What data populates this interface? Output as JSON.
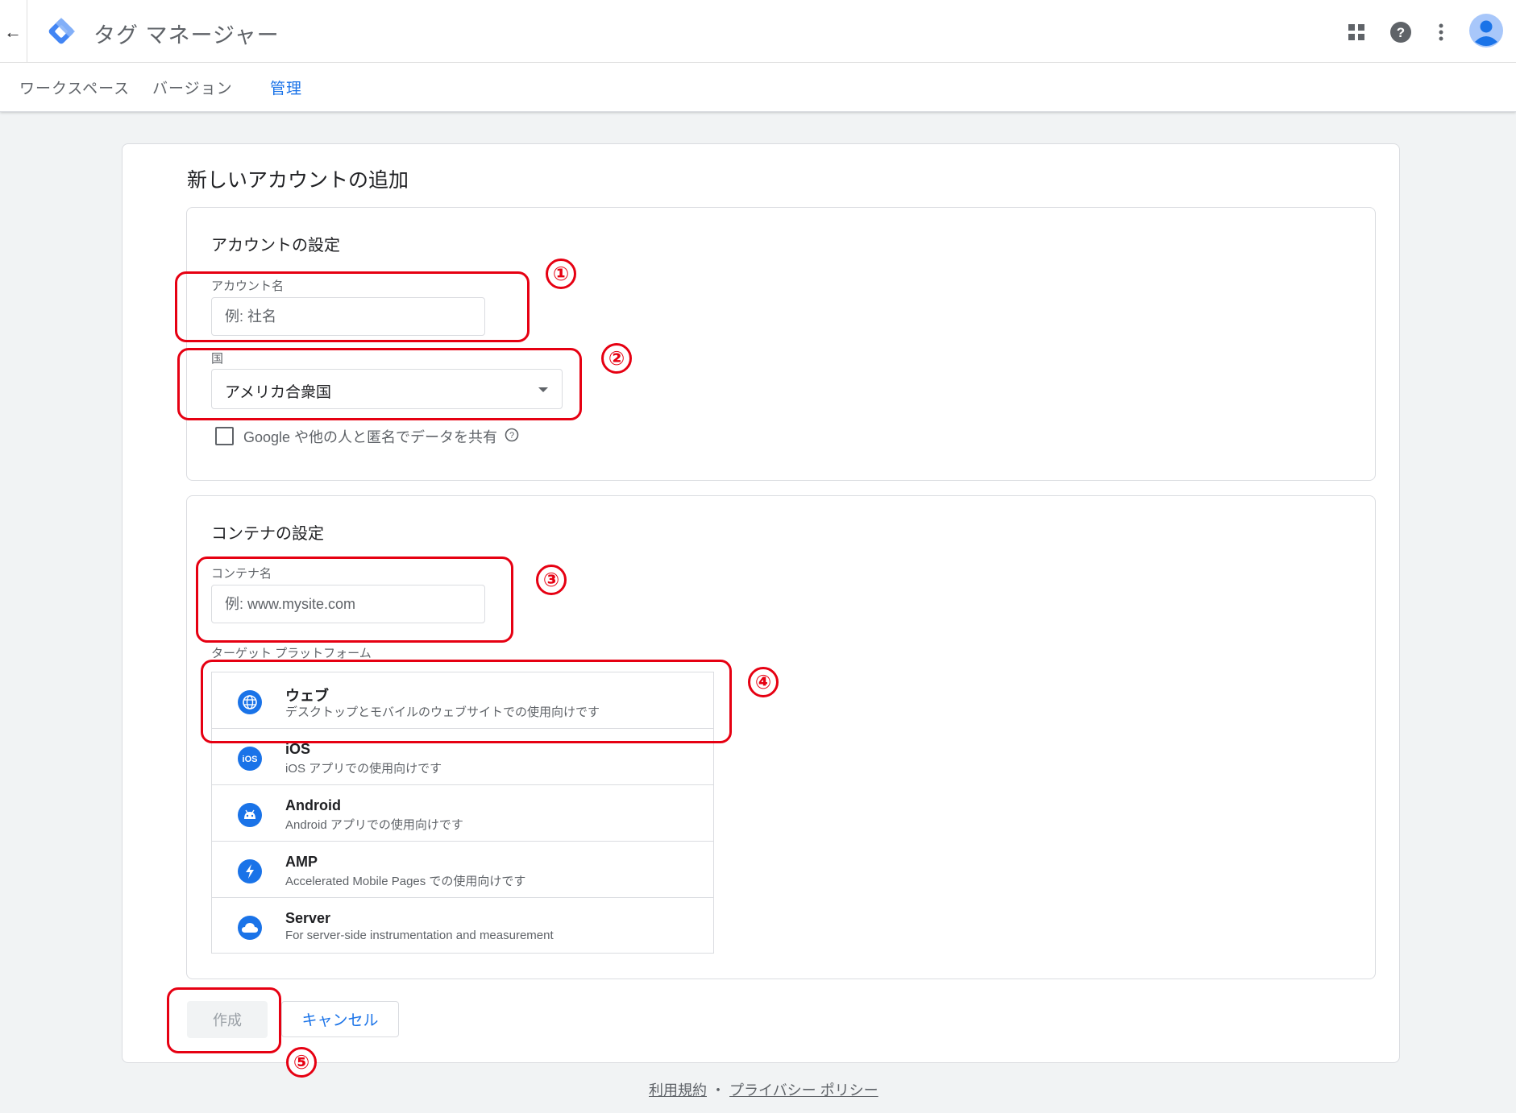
{
  "header": {
    "back_icon": "arrow-back-icon",
    "app_title": "タグ マネージャー",
    "icons": [
      "apps-grid-icon",
      "help-icon",
      "more-vert-icon",
      "account-avatar-icon"
    ]
  },
  "tabs": [
    {
      "label": "ワークスペース",
      "active": false
    },
    {
      "label": "バージョン",
      "active": false
    },
    {
      "label": "管理",
      "active": true
    }
  ],
  "page": {
    "title": "新しいアカウントの追加",
    "account_section": {
      "title": "アカウントの設定",
      "account_name_label": "アカウント名",
      "account_name_placeholder": "例: 社名",
      "country_label": "国",
      "country_value": "アメリカ合衆国",
      "share_data_label": "Google や他の人と匿名でデータを共有"
    },
    "container_section": {
      "title": "コンテナの設定",
      "container_name_label": "コンテナ名",
      "container_name_placeholder": "例: www.mysite.com",
      "platform_label": "ターゲット プラットフォーム",
      "platforms": [
        {
          "name": "ウェブ",
          "description": "デスクトップとモバイルのウェブサイトでの使用向けです",
          "icon": "globe-icon"
        },
        {
          "name": "iOS",
          "description": "iOS アプリでの使用向けです",
          "icon": "ios-icon"
        },
        {
          "name": "Android",
          "description": "Android アプリでの使用向けです",
          "icon": "android-icon"
        },
        {
          "name": "AMP",
          "description": "Accelerated Mobile Pages での使用向けです",
          "icon": "amp-bolt-icon"
        },
        {
          "name": "Server",
          "description": "For server-side instrumentation and measurement",
          "icon": "cloud-icon"
        }
      ]
    },
    "buttons": {
      "create_label": "作成",
      "cancel_label": "キャンセル"
    }
  },
  "footer": {
    "terms_label": "利用規約",
    "separator": "・",
    "privacy_label": "プライバシー ポリシー"
  },
  "annotations": [
    "①",
    "②",
    "③",
    "④",
    "⑤"
  ],
  "colors": {
    "accent": "#1a73e8",
    "annotation": "#e60012",
    "background": "#f1f3f4"
  }
}
